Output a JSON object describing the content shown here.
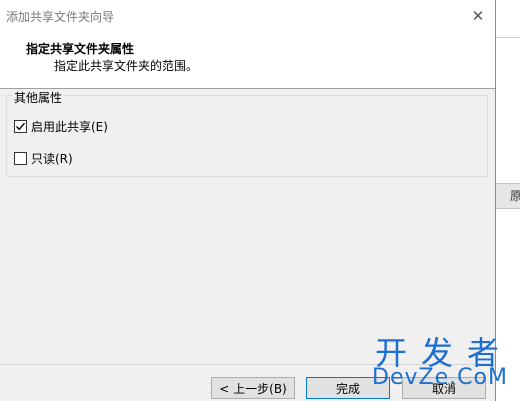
{
  "window": {
    "title": "添加共享文件夹向导",
    "close_glyph": "✕"
  },
  "header": {
    "title": "指定共享文件夹属性",
    "subtitle": "指定此共享文件夹的范围。"
  },
  "group": {
    "legend": "其他属性",
    "options": [
      {
        "label": "启用此共享(E)",
        "checked": true
      },
      {
        "label": "只读(R)",
        "checked": false
      }
    ]
  },
  "buttons": {
    "back": "< 上一步(B)",
    "finish": "完成",
    "cancel": "取消"
  },
  "background_window": {
    "partial_glyph": "原"
  },
  "watermark": {
    "line1": "开发者",
    "line2": "DevZe.CoM"
  },
  "colors": {
    "accent": "#0078d7",
    "watermark": "#1e6fd0"
  }
}
